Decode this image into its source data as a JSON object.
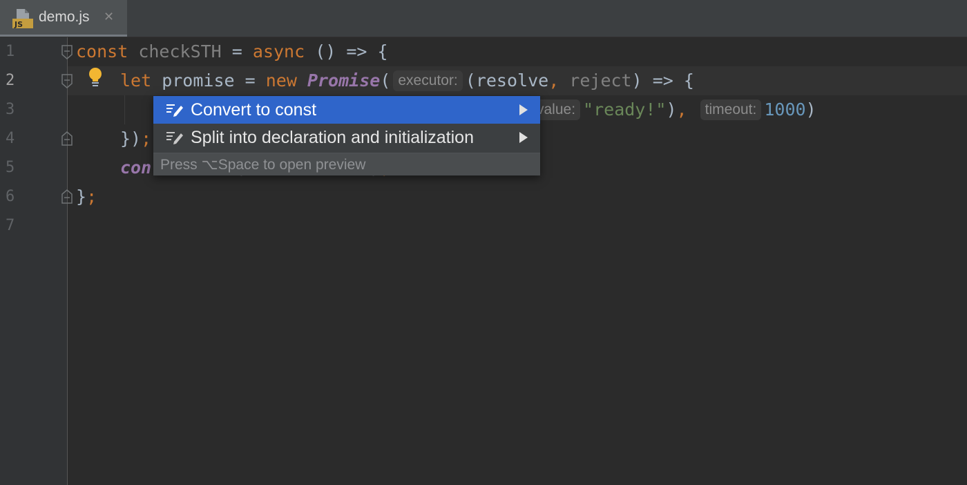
{
  "tab": {
    "filename": "demo.js",
    "close_glyph": "✕",
    "icon": "js-file-icon"
  },
  "line_numbers": [
    "1",
    "2",
    "3",
    "4",
    "5",
    "6",
    "7"
  ],
  "code": {
    "l1": {
      "kw1": "const",
      "name": " checkSTH",
      "eq": " = ",
      "kw2": "async",
      "rest": " () => {"
    },
    "l2": {
      "kw1": "let",
      "name": " promise",
      "eq": " = ",
      "kw2": "new",
      "sp": " ",
      "cls": "Promise",
      "paren": "(",
      "hint": "executor:",
      "args1": "(resolve",
      "comma": ",",
      "args2": " reject",
      "rest": ") => {"
    },
    "l3": {
      "hint1": "value:",
      "str": "\"ready!\"",
      "close": ")",
      "comma": ",",
      "hint2": "timeout:",
      "num": "1000",
      "end": ")"
    },
    "l4": {
      "brace": "})",
      "semi": ";"
    },
    "l5": {
      "kw": "con",
      "rest": "        (            )",
      "semi": ";"
    },
    "l6": {
      "brace": "}",
      "semi": ";"
    }
  },
  "popup": {
    "items": [
      {
        "label": "Convert to const",
        "icon": "intention-edit-icon",
        "selected": true
      },
      {
        "label": "Split into declaration and initialization",
        "icon": "intention-edit-icon",
        "selected": false
      }
    ],
    "footer": "Press ⌥Space to open preview"
  },
  "colors": {
    "keyword": "#cc7832",
    "string": "#6a8759",
    "number": "#6897bb",
    "class": "#9876aa",
    "selection": "#2f65ca"
  }
}
